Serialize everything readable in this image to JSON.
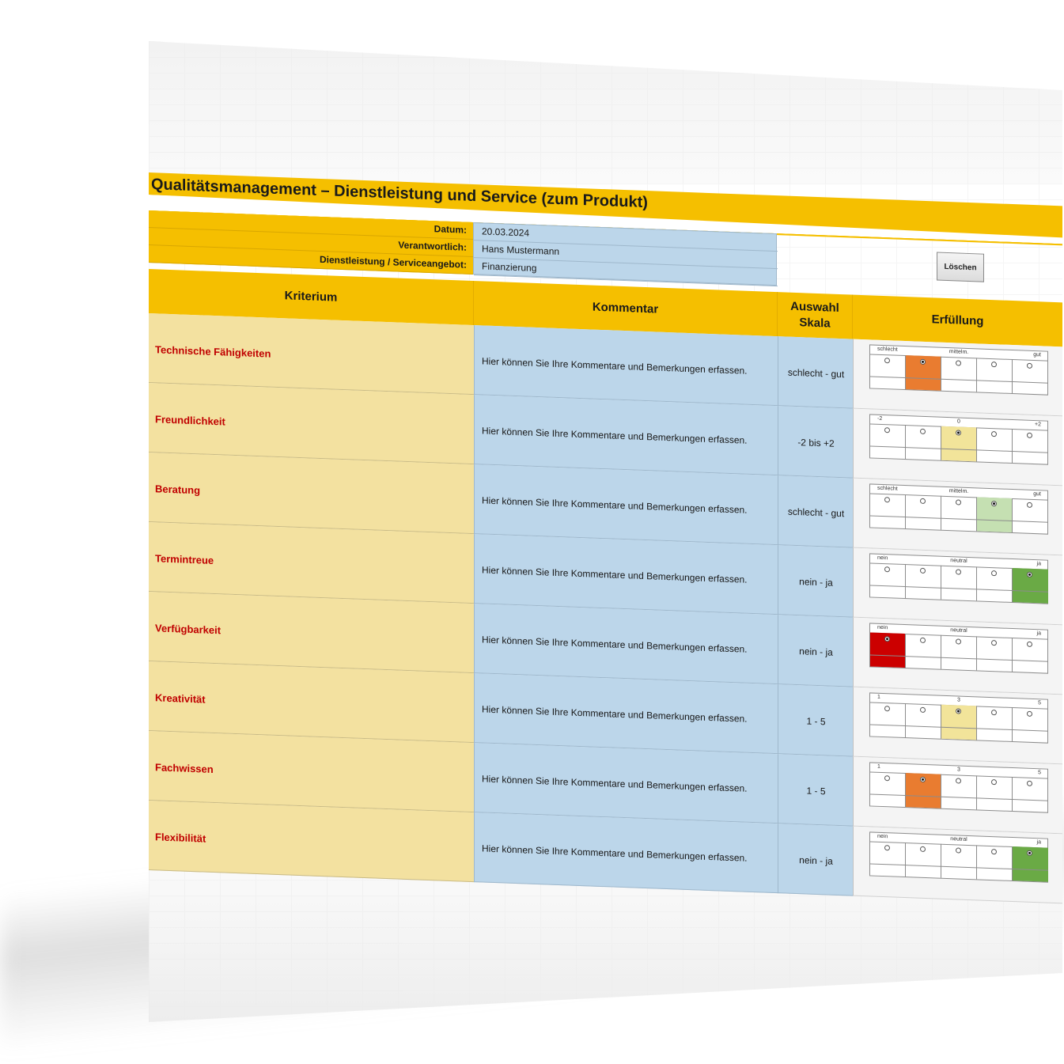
{
  "title": "Qualitätsmanagement – Dienstleistung und Service (zum Produkt)",
  "info": [
    {
      "label": "Datum:",
      "value": "20.03.2024"
    },
    {
      "label": "Verantwortlich:",
      "value": "Hans Mustermann"
    },
    {
      "label": "Dienstleistung / Serviceangebot:",
      "value": "Finanzierung"
    }
  ],
  "button_loeschen": "Löschen",
  "headers": {
    "kriterium": "Kriterium",
    "kommentar": "Kommentar",
    "skala_line1": "Auswahl",
    "skala_line2": "Skala",
    "erfuellung": "Erfüllung"
  },
  "rows": [
    {
      "kriterium": "Technische Fähigkeiten",
      "kommentar": "Hier können Sie Ihre Kommentare und Bemerkungen erfassen.",
      "skala": "schlecht - gut",
      "labels": [
        "schlecht",
        "mittelm.",
        "gut"
      ],
      "selected": 2,
      "color": "#e97c30"
    },
    {
      "kriterium": "Freundlichkeit",
      "kommentar": "Hier können Sie Ihre Kommentare und Bemerkungen erfassen.",
      "skala": "-2 bis +2",
      "labels": [
        "-2",
        "0",
        "+2"
      ],
      "selected": 3,
      "color": "#f2e49a"
    },
    {
      "kriterium": "Beratung",
      "kommentar": "Hier können Sie Ihre Kommentare und Bemerkungen erfassen.",
      "skala": "schlecht - gut",
      "labels": [
        "schlecht",
        "mittelm.",
        "gut"
      ],
      "selected": 4,
      "color": "#c5e0b2"
    },
    {
      "kriterium": "Termintreue",
      "kommentar": "Hier können Sie Ihre Kommentare und Bemerkungen erfassen.",
      "skala": "nein - ja",
      "labels": [
        "nein",
        "neutral",
        "ja"
      ],
      "selected": 5,
      "color": "#6aaa45"
    },
    {
      "kriterium": "Verfügbarkeit",
      "kommentar": "Hier können Sie Ihre Kommentare und Bemerkungen erfassen.",
      "skala": "nein - ja",
      "labels": [
        "nein",
        "neutral",
        "ja"
      ],
      "selected": 1,
      "color": "#cc0000"
    },
    {
      "kriterium": "Kreativität",
      "kommentar": "Hier können Sie Ihre Kommentare und Bemerkungen erfassen.",
      "skala": "1 - 5",
      "labels": [
        "1",
        "3",
        "5"
      ],
      "selected": 3,
      "color": "#f2e49a"
    },
    {
      "kriterium": "Fachwissen",
      "kommentar": "Hier können Sie Ihre Kommentare und Bemerkungen erfassen.",
      "skala": "1 - 5",
      "labels": [
        "1",
        "3",
        "5"
      ],
      "selected": 2,
      "color": "#e97c30"
    },
    {
      "kriterium": "Flexibilität",
      "kommentar": "Hier können Sie Ihre Kommentare und Bemerkungen erfassen.",
      "skala": "nein - ja",
      "labels": [
        "nein",
        "neutral",
        "ja"
      ],
      "selected": 5,
      "color": "#6aaa45"
    }
  ]
}
